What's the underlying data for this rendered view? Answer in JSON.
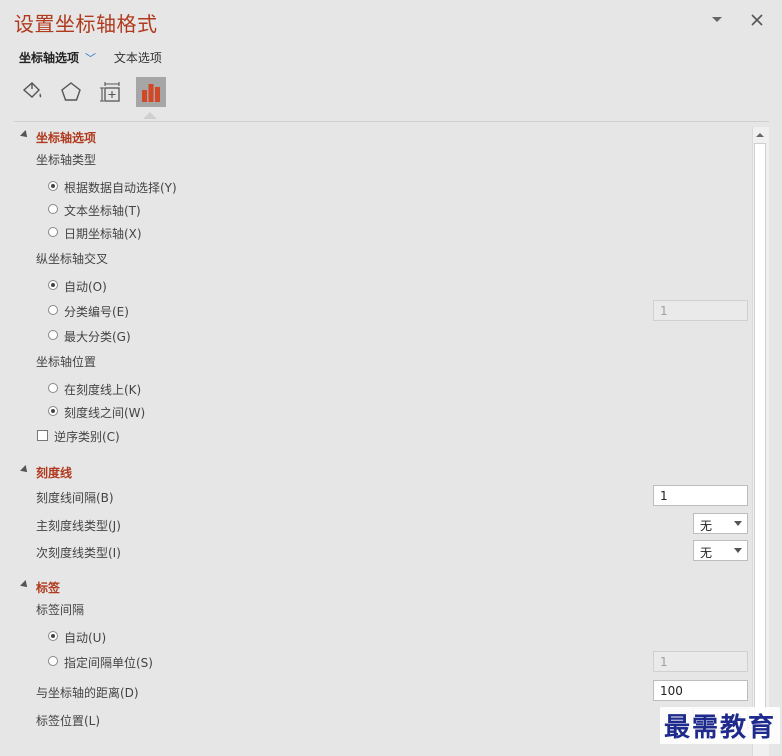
{
  "pane": {
    "title": "设置坐标轴格式",
    "pin_icon": "chevron-down-icon",
    "close_icon": "close-icon",
    "tabs": [
      "坐标轴选项",
      "文本选项"
    ],
    "icon_tabs": [
      "fill-line-icon",
      "effects-icon",
      "size-properties-icon",
      "axis-options-icon"
    ],
    "accent_color": "#b03a1e"
  },
  "axis_options": {
    "heading": "坐标轴选项",
    "axis_type": {
      "label": "坐标轴类型",
      "options": [
        "根据数据自动选择(Y)",
        "文本坐标轴(T)",
        "日期坐标轴(X)"
      ],
      "selected": "根据数据自动选择(Y)"
    },
    "vertical_cross": {
      "label": "纵坐标轴交叉",
      "options": [
        "自动(O)",
        "分类编号(E)",
        "最大分类(G)"
      ],
      "selected": "自动(O)",
      "category_number": "1"
    },
    "axis_position": {
      "label": "坐标轴位置",
      "options": [
        "在刻度线上(K)",
        "刻度线之间(W)"
      ],
      "selected": "刻度线之间(W)"
    },
    "reverse_label": "逆序类别(C)",
    "reverse_checked": false
  },
  "tick_marks": {
    "heading": "刻度线",
    "interval_label": "刻度线间隔(B)",
    "interval_value": "1",
    "major_label": "主刻度线类型(J)",
    "major_value": "无",
    "minor_label": "次刻度线类型(I)",
    "minor_value": "无"
  },
  "labels": {
    "heading": "标签",
    "interval_label": "标签间隔",
    "options": [
      "自动(U)",
      "指定间隔单位(S)"
    ],
    "selected": "自动(U)",
    "unit_value": "1",
    "distance_label": "与坐标轴的距离(D)",
    "distance_value": "100",
    "position_label": "标签位置(L)"
  },
  "watermark": "最需教育"
}
